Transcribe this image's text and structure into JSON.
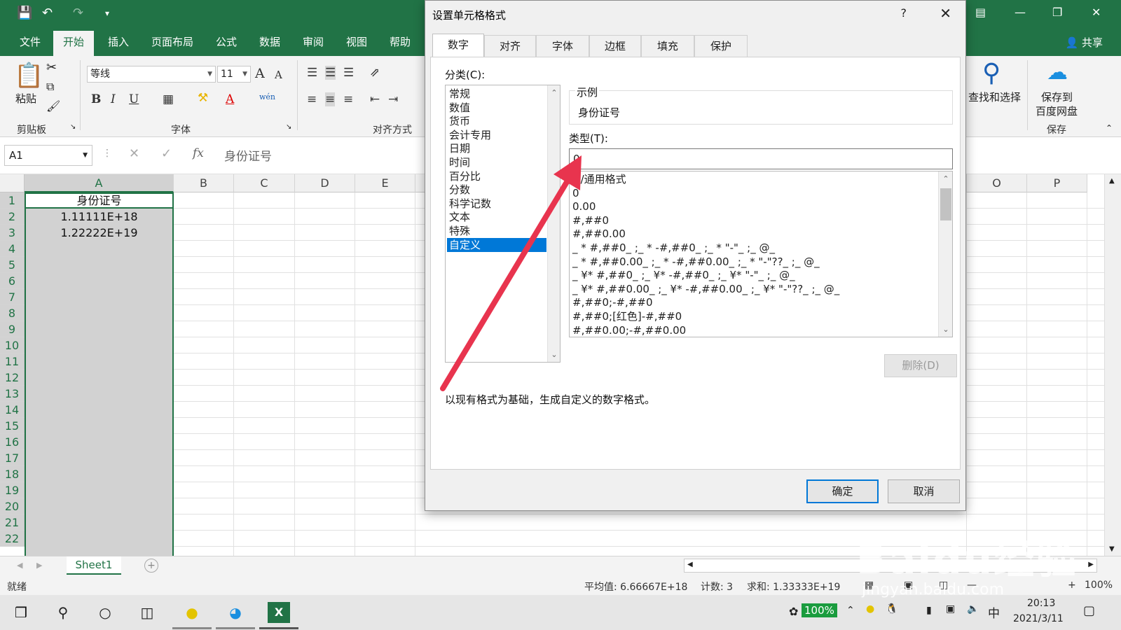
{
  "ribbon": {
    "tabs": [
      "文件",
      "开始",
      "插入",
      "页面布局",
      "公式",
      "数据",
      "审阅",
      "视图",
      "帮助"
    ],
    "active_tab": "开始",
    "share": "共享",
    "paste": "粘贴",
    "clipboard_group": "剪贴板",
    "font_group": "字体",
    "align_group": "对齐方式",
    "font_name": "等线",
    "font_size": "11",
    "find_select": "查找和选择",
    "save_to_baidu_1": "保存到",
    "save_to_baidu_2": "百度网盘",
    "save_group": "保存",
    "bold": "B",
    "italic": "I",
    "underline": "U",
    "wen": "wén",
    "font_color_letter": "A",
    "grow_font": "A",
    "shrink_font": "A"
  },
  "formula_bar": {
    "name_box": "A1",
    "fx": "fx",
    "content": "身份证号"
  },
  "sheet": {
    "columns": [
      "A",
      "B",
      "C",
      "D",
      "E",
      "O",
      "P"
    ],
    "rows": [
      "1",
      "2",
      "3",
      "4",
      "5",
      "6",
      "7",
      "8",
      "9",
      "10",
      "11",
      "12",
      "13",
      "14",
      "15",
      "16",
      "17",
      "18",
      "19",
      "20",
      "21",
      "22"
    ],
    "cells": {
      "A1": "身份证号",
      "A2": "1.11111E+18",
      "A3": "1.22222E+19"
    },
    "tab_name": "Sheet1"
  },
  "status": {
    "ready": "就绪",
    "average": "平均值: 6.66667E+18",
    "count": "计数: 3",
    "sum": "求和: 1.33333E+19",
    "zoom": "100%"
  },
  "dialog": {
    "title": "设置单元格格式",
    "help": "?",
    "tabs": [
      "数字",
      "对齐",
      "字体",
      "边框",
      "填充",
      "保护"
    ],
    "active_tab": "数字",
    "category_label": "分类(C):",
    "categories": [
      "常规",
      "数值",
      "货币",
      "会计专用",
      "日期",
      "时间",
      "百分比",
      "分数",
      "科学记数",
      "文本",
      "特殊",
      "自定义"
    ],
    "selected_category": "自定义",
    "sample_label": "示例",
    "sample_value": "身份证号",
    "type_label": "类型(T):",
    "type_value": "0",
    "formats": [
      "G/通用格式",
      "0",
      "0.00",
      "#,##0",
      "#,##0.00",
      "_ * #,##0_ ;_ * -#,##0_ ;_ * \"-\"_ ;_ @_",
      "_ * #,##0.00_ ;_ * -#,##0.00_ ;_ * \"-\"??_ ;_ @_",
      "_ ¥* #,##0_ ;_ ¥* -#,##0_ ;_ ¥* \"-\"_ ;_ @_",
      "_ ¥* #,##0.00_ ;_ ¥* -#,##0.00_ ;_ ¥* \"-\"??_ ;_ @_",
      "#,##0;-#,##0",
      "#,##0;[红色]-#,##0",
      "#,##0.00;-#,##0.00"
    ],
    "delete_button": "删除(D)",
    "description": "以现有格式为基础，生成自定义的数字格式。",
    "ok_button": "确定",
    "cancel_button": "取消"
  },
  "taskbar": {
    "battery": "100%",
    "ime": "中",
    "time": "20:13",
    "date": "2021/3/11"
  },
  "watermark": {
    "brand": "Baidu经验",
    "url": "jingyan.baidu.com"
  },
  "colors": {
    "excel_green": "#217346",
    "selection_blue": "#0078d7",
    "arrow_red": "#e8344e"
  },
  "icons": [
    "save-icon",
    "undo-icon",
    "redo-icon",
    "paste-icon",
    "cut-icon",
    "copy-icon",
    "format-painter-icon",
    "search-icon",
    "baidu-cloud-icon",
    "windows-start-icon",
    "search-taskbar-icon",
    "cortana-icon",
    "task-view-icon",
    "edge-icon",
    "excel-icon"
  ]
}
